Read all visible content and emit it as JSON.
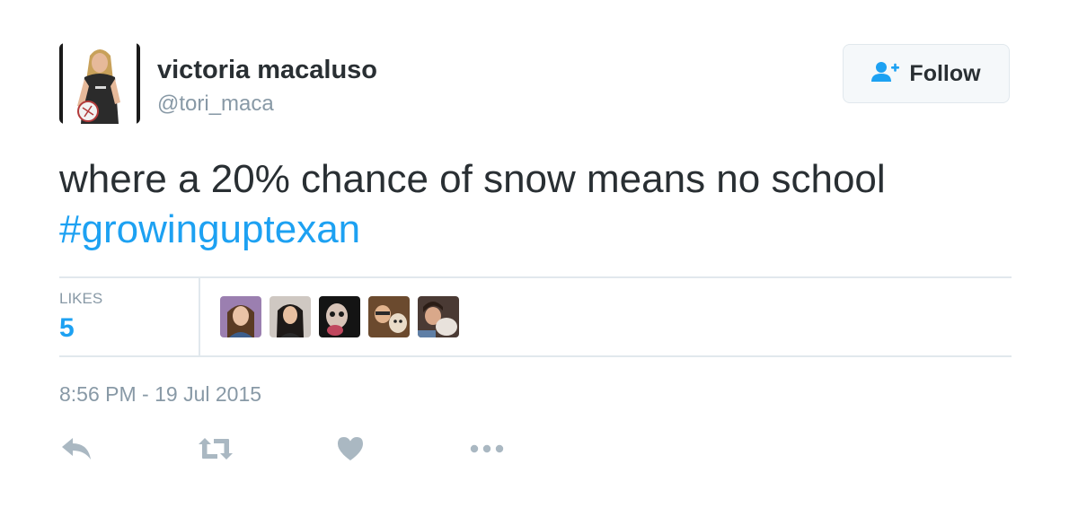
{
  "user": {
    "fullname": "victoria macaluso",
    "username": "@tori_maca",
    "avatar_icon": "profile-photo"
  },
  "follow_button": {
    "label": "Follow",
    "icon": "follow-user-icon"
  },
  "tweet": {
    "text": "where a 20% chance of snow means no school",
    "hashtag": "#growinguptexan"
  },
  "stats": {
    "likes_label": "LIKES",
    "likes_count": "5",
    "likers": [
      "liker-avatar-1",
      "liker-avatar-2",
      "liker-avatar-3",
      "liker-avatar-4",
      "liker-avatar-5"
    ]
  },
  "timestamp": "8:56 PM - 19 Jul 2015",
  "actions": {
    "icons": [
      "reply-icon",
      "retweet-icon",
      "like-icon",
      "more-icon"
    ]
  },
  "colors": {
    "accent": "#1da1f2",
    "text": "#292f33",
    "muted": "#8899a6",
    "action_icon": "#aab8c2",
    "divider": "#e1e8ed"
  }
}
